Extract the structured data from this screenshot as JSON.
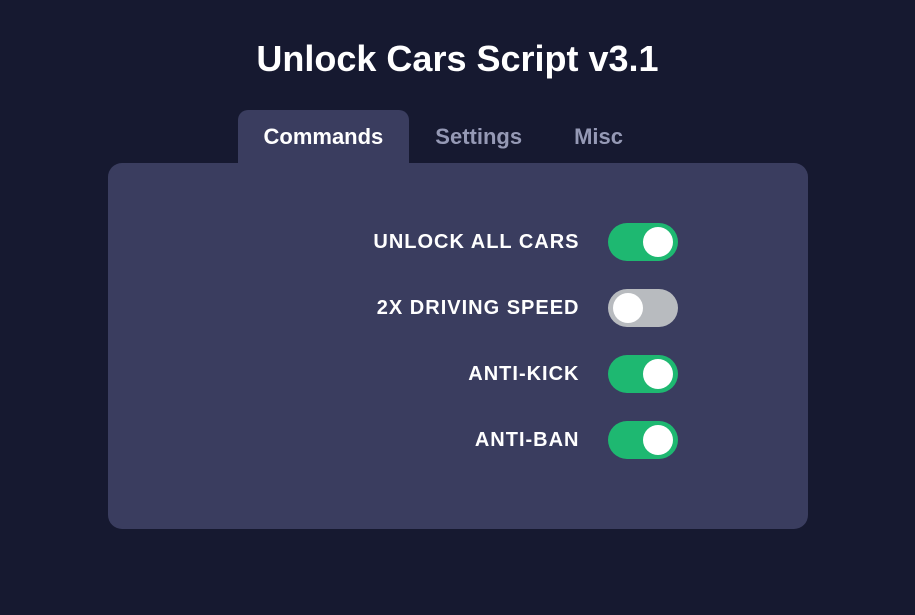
{
  "title": "Unlock Cars Script v3.1",
  "tabs": [
    {
      "label": "Commands",
      "active": true
    },
    {
      "label": "Settings",
      "active": false
    },
    {
      "label": "Misc",
      "active": false
    }
  ],
  "commands": [
    {
      "label": "UNLOCK ALL CARS",
      "enabled": true
    },
    {
      "label": "2X DRIVING SPEED",
      "enabled": false
    },
    {
      "label": "ANTI-KICK",
      "enabled": true
    },
    {
      "label": "ANTI-BAN",
      "enabled": true
    }
  ],
  "colors": {
    "background": "#161930",
    "panel": "#3a3d5f",
    "toggle_on": "#1eb871",
    "toggle_off": "#b8bbbf",
    "tab_inactive": "#9599b5"
  }
}
